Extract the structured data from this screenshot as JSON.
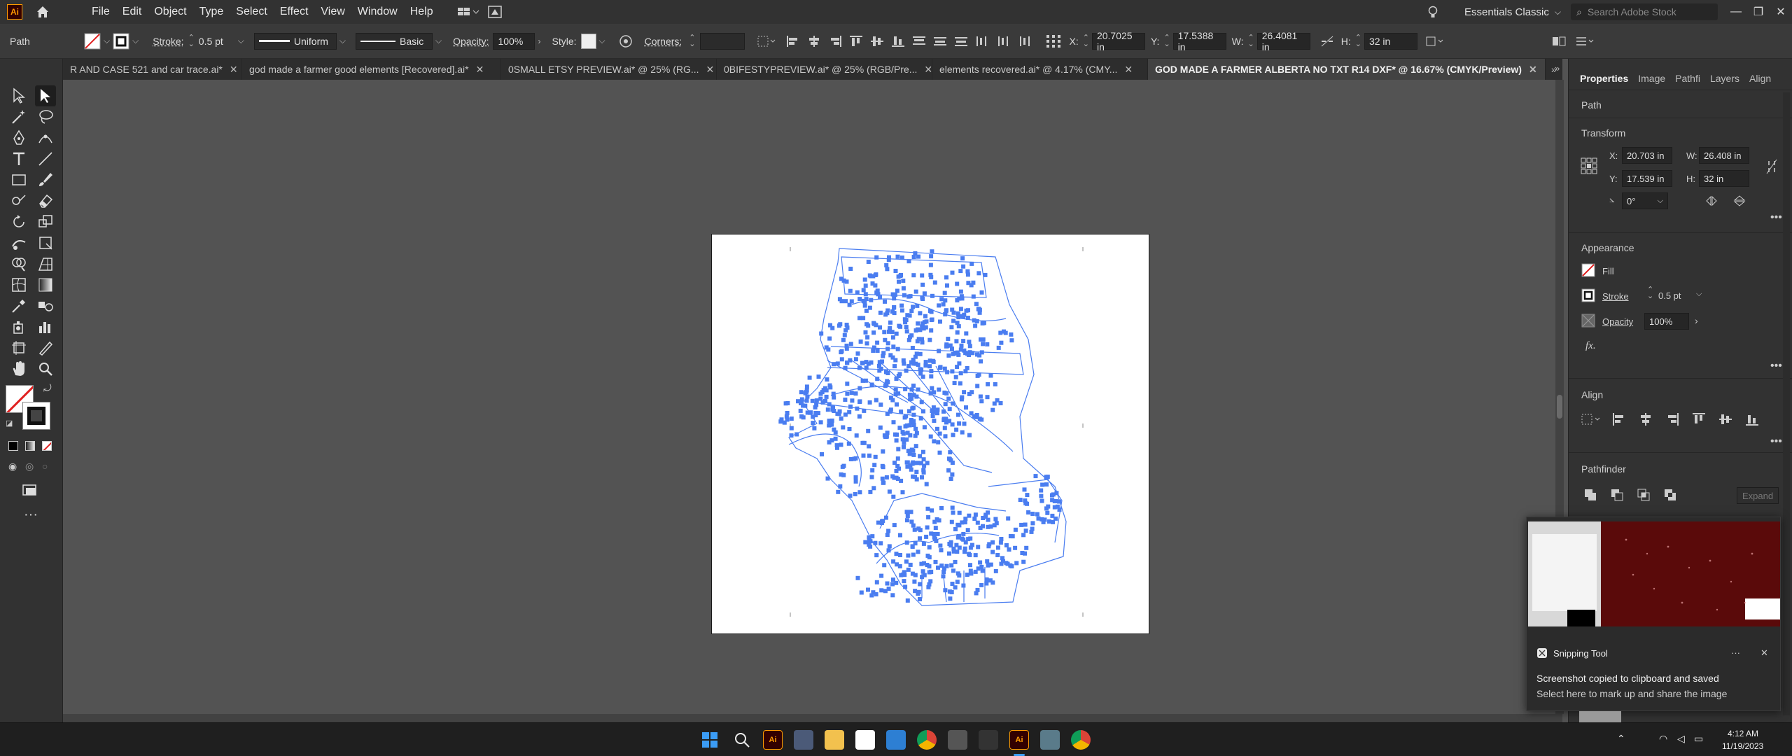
{
  "app": {
    "logo_text": "Ai",
    "workspace": "Essentials Classic",
    "search_placeholder": "Search Adobe Stock"
  },
  "menu": {
    "items": [
      "File",
      "Edit",
      "Object",
      "Type",
      "Select",
      "Effect",
      "View",
      "Window",
      "Help"
    ]
  },
  "control_bar": {
    "selection_label": "Path",
    "stroke_label": "Stroke:",
    "stroke_value": "0.5 pt",
    "uniform_label": "Uniform",
    "basic_label": "Basic",
    "opacity_label": "Opacity:",
    "opacity_value": "100%",
    "style_label": "Style:",
    "corners_label": "Corners:",
    "x_label": "X:",
    "x_value": "20.7025 in",
    "y_label": "Y:",
    "y_value": "17.5388 in",
    "w_label": "W:",
    "w_value": "26.4081 in",
    "h_label": "H:",
    "h_value": "32 in"
  },
  "tabs": [
    {
      "label": "R AND CASE 521 and car trace.ai*",
      "active": false
    },
    {
      "label": "god made a farmer good elements [Recovered].ai*",
      "active": false
    },
    {
      "label": "0SMALL ETSY PREVIEW.ai* @ 25% (RG...",
      "active": false
    },
    {
      "label": "0BIFESTYPREVIEW.ai* @ 25% (RGB/Pre...",
      "active": false
    },
    {
      "label": "elements recovered.ai* @ 4.17% (CMY...",
      "active": false
    },
    {
      "label": "GOD MADE A FARMER ALBERTA NO TXT R14 DXF* @ 16.67% (CMYK/Preview)",
      "active": true
    }
  ],
  "panel": {
    "tabs": [
      "Properties",
      "Image",
      "Pathfi",
      "Layers",
      "Align"
    ],
    "selection_type": "Path",
    "transform_title": "Transform",
    "x_label": "X:",
    "x_value": "20.703 in",
    "y_label": "Y:",
    "y_value": "17.539 in",
    "w_label": "W:",
    "w_value": "26.408 in",
    "h_label": "H:",
    "h_value": "32 in",
    "angle_value": "0°",
    "appearance_title": "Appearance",
    "fill_label": "Fill",
    "stroke_label": "Stroke",
    "stroke_value": "0.5 pt",
    "opacity_label": "Opacity",
    "opacity_value": "100%",
    "fx_label": "fx.",
    "align_title": "Align",
    "pathfinder_title": "Pathfinder",
    "expand_label": "Expand"
  },
  "notification": {
    "app_name": "Snipping Tool",
    "title": "Screenshot copied to clipboard and saved",
    "body": "Select here to mark up and share the image",
    "more": "···",
    "close": "✕"
  },
  "taskbar": {
    "time": "4:12 AM",
    "date": "11/19/2023"
  },
  "colors": {
    "path_blue": "#4a7df0",
    "ai_orange": "#ff9a00",
    "ui_dark": "#323232",
    "canvas": "#535353"
  }
}
